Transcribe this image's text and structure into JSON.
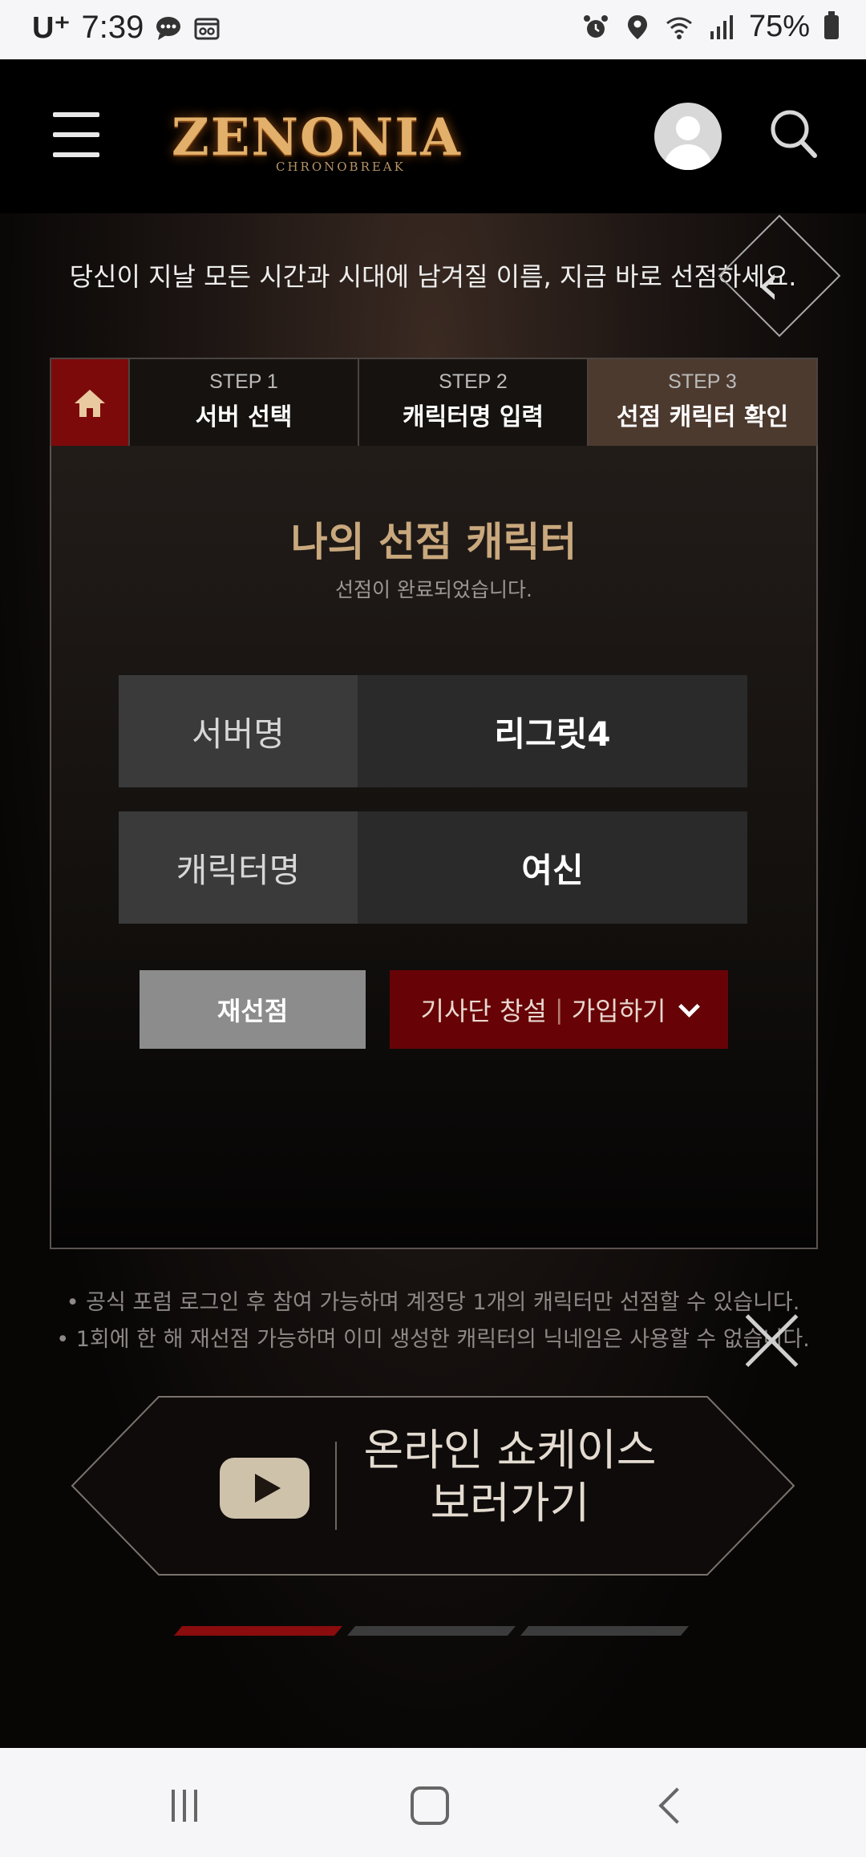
{
  "status_bar": {
    "carrier": "U⁺",
    "time": "7:39",
    "battery": "75%"
  },
  "header": {
    "logo_text": "ZENONIA",
    "logo_subtext": "CHRONOBREAK"
  },
  "hero": {
    "intro_text": "당신이 지날 모든 시간과 시대에 남겨질 이름, 지금 바로 선점하세요."
  },
  "steps": [
    {
      "num": "STEP 1",
      "title": "서버 선택",
      "active": false
    },
    {
      "num": "STEP 2",
      "title": "캐릭터명 입력",
      "active": false
    },
    {
      "num": "STEP 3",
      "title": "선점 캐릭터 확인",
      "active": true
    }
  ],
  "panel": {
    "title": "나의 선점 캐릭터",
    "subtitle": "선점이 완료되었습니다.",
    "rows": [
      {
        "key": "서버명",
        "value": "리그릿4"
      },
      {
        "key": "캐릭터명",
        "value": "여신"
      }
    ],
    "reselect_label": "재선점",
    "guild_create_label": "기사단 창설",
    "guild_sep": "|",
    "guild_join_label": "가입하기"
  },
  "notes": [
    "• 공식 포럼 로그인 후 참여 가능하며 계정당 1개의 캐릭터만 선점할 수 있습니다.",
    "• 1회에 한 해 재선점 가능하며 이미 생성한 캐릭터의 닉네임은 사용할 수 없습니다."
  ],
  "showcase": {
    "line1": "온라인 쇼케이스",
    "line2": "보러가기"
  },
  "pagination": {
    "count": 3,
    "active_index": 0,
    "active_color": "#8a0c0c",
    "inactive_color": "#3b3b3b"
  },
  "colors": {
    "accent_gold": "#c9a87d",
    "accent_red": "#670306",
    "home_red": "#7d0a0a",
    "active_step": "#4d3a2f"
  }
}
